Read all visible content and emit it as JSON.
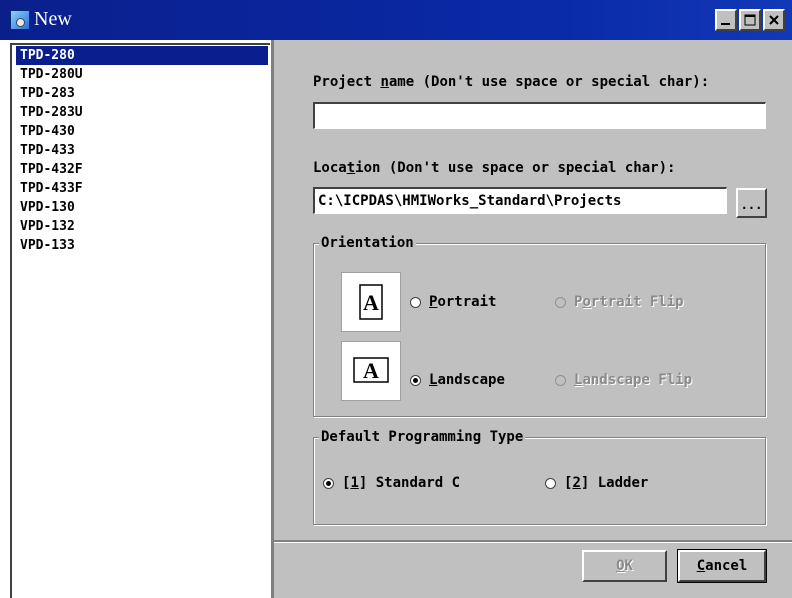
{
  "window": {
    "title": "New",
    "controls": {
      "minimize": "_",
      "maximize": "□",
      "close": "X"
    }
  },
  "models": {
    "selected_index": 0,
    "items": [
      "TPD-280",
      "TPD-280U",
      "TPD-283",
      "TPD-283U",
      "TPD-430",
      "TPD-433",
      "TPD-432F",
      "TPD-433F",
      "VPD-130",
      "VPD-132",
      "VPD-133"
    ]
  },
  "project_name": {
    "label_pre": "Project ",
    "label_key": "n",
    "label_post": "ame (Don't use space or special char):",
    "value": ""
  },
  "location": {
    "label_pre": "Loca",
    "label_key": "t",
    "label_post": "ion (Don't use space or special char):",
    "value": "C:\\ICPDAS\\HMIWorks_Standard\\Projects",
    "browse_label": "..."
  },
  "orientation": {
    "legend": "Orientation",
    "icon_glyph": "A",
    "options": {
      "portrait": {
        "key": "P",
        "rest": "ortrait",
        "checked": false,
        "enabled": true
      },
      "portrait_flip": {
        "pre": "P",
        "key": "o",
        "rest": "rtrait Flip",
        "checked": false,
        "enabled": false
      },
      "landscape": {
        "key": "L",
        "rest": "andscape",
        "checked": true,
        "enabled": true
      },
      "landscape_flip": {
        "key": "L",
        "rest": "andscape Flip",
        "checked": false,
        "enabled": false
      }
    }
  },
  "programming_type": {
    "legend": "Default Programming Type",
    "options": {
      "standard_c": {
        "pre": "[",
        "key": "1",
        "post": "] Standard C",
        "checked": true
      },
      "ladder": {
        "pre": "[",
        "key": "2",
        "post": "] Ladder",
        "checked": false
      }
    }
  },
  "buttons": {
    "ok": {
      "key": "O",
      "rest": "K",
      "enabled": false
    },
    "cancel": {
      "key": "C",
      "rest": "ancel",
      "enabled": true
    }
  },
  "colors": {
    "titlebar": "#0a1f8c",
    "selection": "#0a1f8c",
    "face": "#c0c0c0"
  }
}
